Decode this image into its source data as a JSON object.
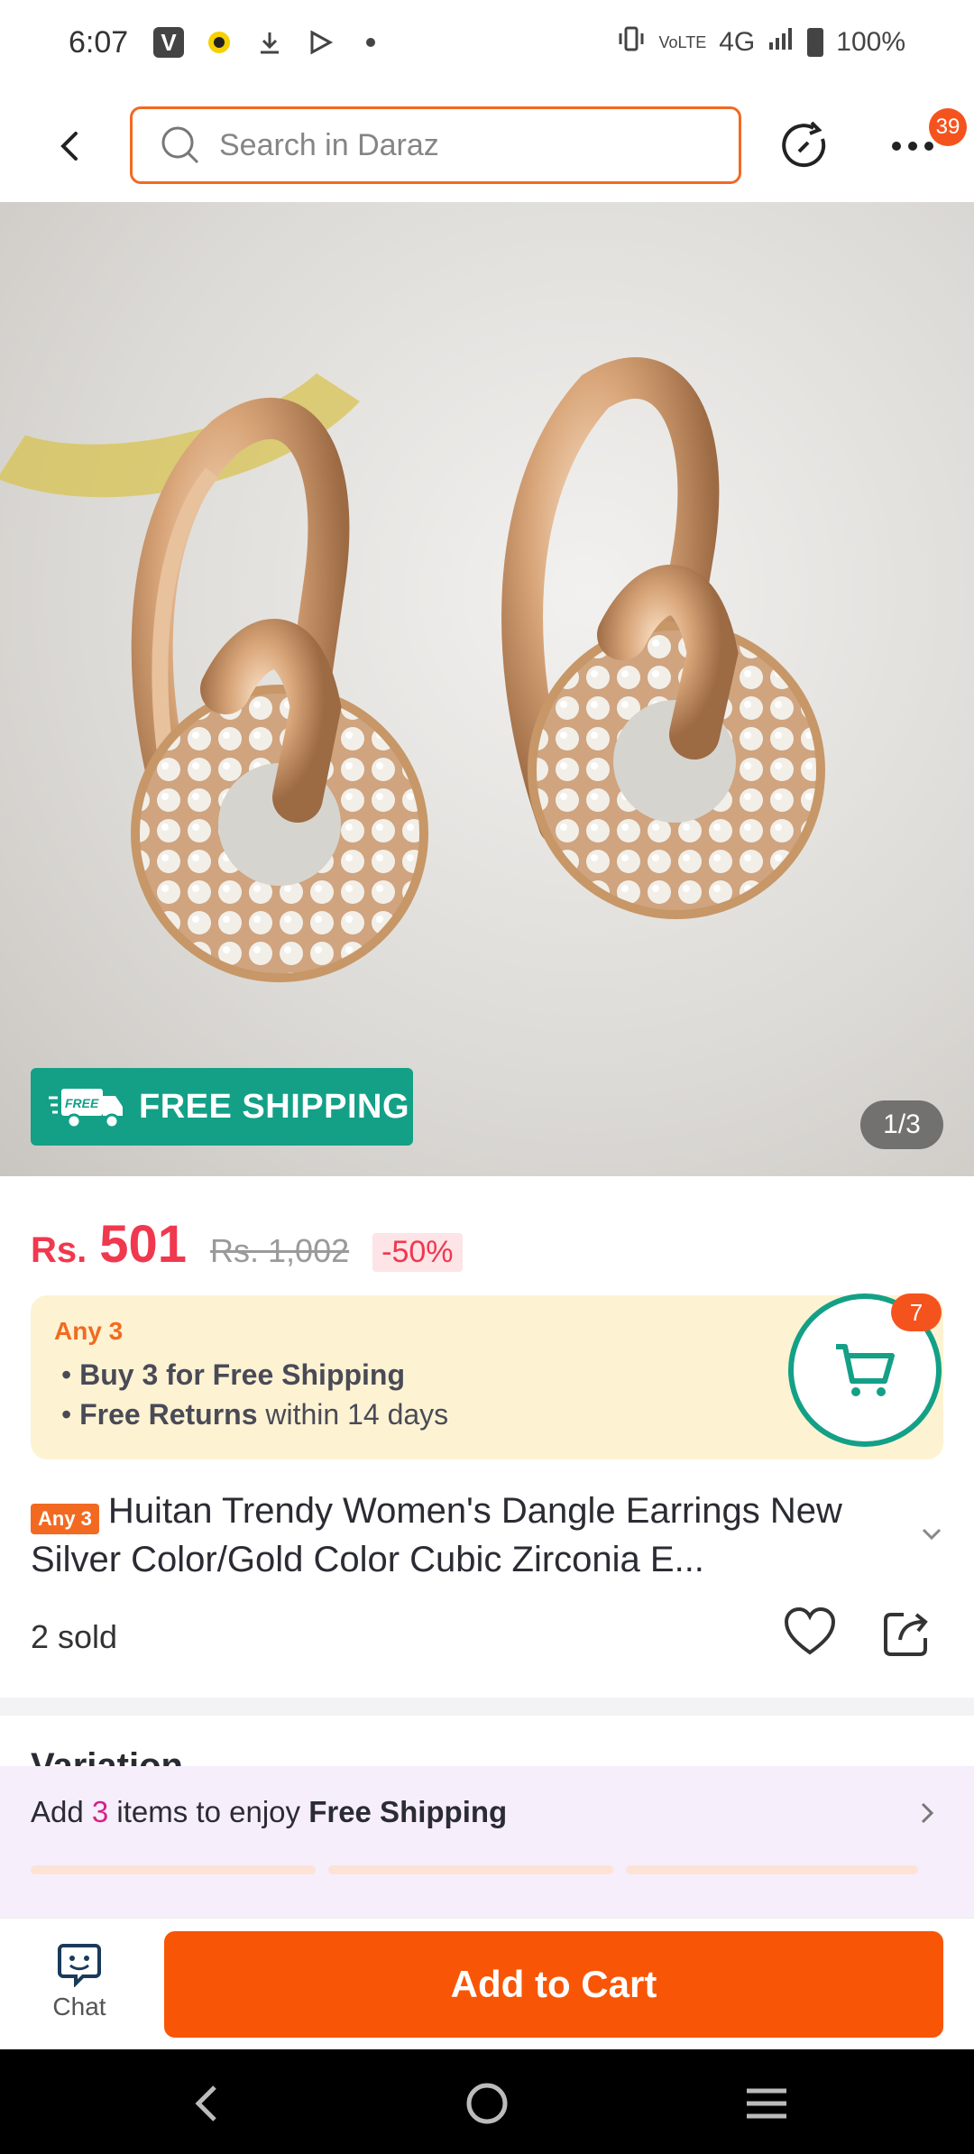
{
  "status_bar": {
    "time": "6:07",
    "left_icons": [
      "vpn-icon",
      "snapchat-icon",
      "download-icon",
      "play-store-icon",
      "dot-icon"
    ],
    "network": "4G",
    "battery": "100%"
  },
  "top_nav": {
    "search_placeholder": "Search in Daraz",
    "notification_count": "39"
  },
  "product_image": {
    "free_shipping_label": "FREE SHIPPING",
    "free_truck_text": "FREE",
    "image_counter": "1/3"
  },
  "price": {
    "currency": "Rs.",
    "current": "501",
    "original": "Rs. 1,002",
    "discount": "-50%"
  },
  "promo": {
    "tag": "Any 3",
    "line1_bold": "Buy 3 for  Free Shipping",
    "line2_bold": "Free Returns",
    "line2_rest": " within 14 days",
    "cart_count": "7"
  },
  "product": {
    "title_tag": "Any 3",
    "title": "Huitan Trendy Women's Dangle Earrings New Silver Color/Gold Color Cubic Zirconia E...",
    "sold": "2 sold"
  },
  "variation_peek": "Variation",
  "ship_banner": {
    "prefix": "Add ",
    "count": "3",
    "middle": " items to enjoy ",
    "bold": "Free Shipping"
  },
  "bottom_bar": {
    "chat_label": "Chat",
    "add_to_cart_label": "Add to Cart"
  },
  "colors": {
    "accent": "#f85606",
    "price_red": "#f0384f",
    "free_ship_green": "#13a087",
    "promo_bg": "#fdf3d3"
  }
}
